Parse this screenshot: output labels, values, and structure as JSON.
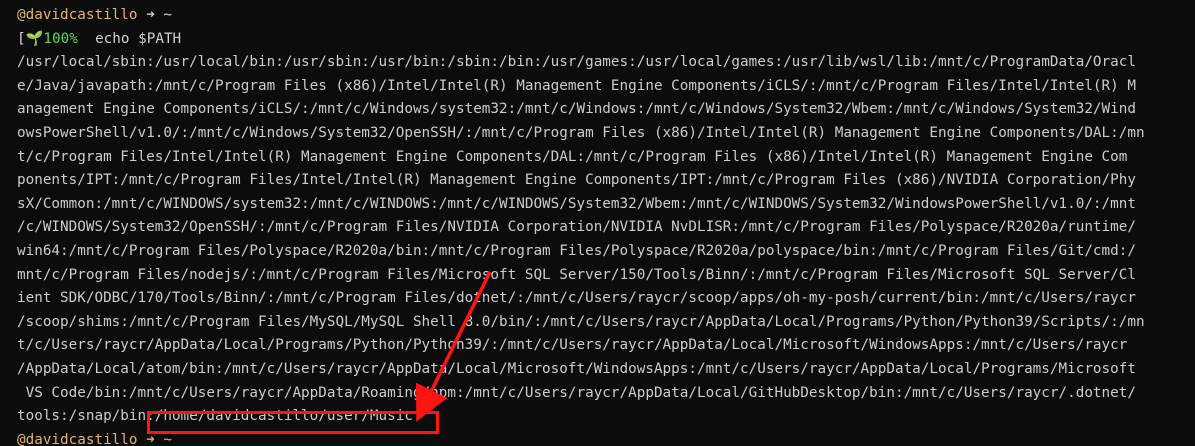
{
  "terminal": {
    "prompt_user": "@davidcastillo",
    "prompt_arrow": "➜",
    "prompt_dir": "~",
    "battery_icon": "seedling-icon",
    "battery_open": "[",
    "battery_glyph": "🌱",
    "battery_pct": "100%",
    "command": "echo $PATH",
    "output_lines": [
      "/usr/local/sbin:/usr/local/bin:/usr/sbin:/usr/bin:/sbin:/bin:/usr/games:/usr/local/games:/usr/lib/wsl/lib:/mnt/c/ProgramData/Oracl",
      "e/Java/javapath:/mnt/c/Program Files (x86)/Intel/Intel(R) Management Engine Components/iCLS/:/mnt/c/Program Files/Intel/Intel(R) M",
      "anagement Engine Components/iCLS/:/mnt/c/Windows/system32:/mnt/c/Windows:/mnt/c/Windows/System32/Wbem:/mnt/c/Windows/System32/Wind",
      "owsPowerShell/v1.0/:/mnt/c/Windows/System32/OpenSSH/:/mnt/c/Program Files (x86)/Intel/Intel(R) Management Engine Components/DAL:/mn",
      "t/c/Program Files/Intel/Intel(R) Management Engine Components/DAL:/mnt/c/Program Files (x86)/Intel/Intel(R) Management Engine Com",
      "ponents/IPT:/mnt/c/Program Files/Intel/Intel(R) Management Engine Components/IPT:/mnt/c/Program Files (x86)/NVIDIA Corporation/Phy",
      "sX/Common:/mnt/c/WINDOWS/system32:/mnt/c/WINDOWS:/mnt/c/WINDOWS/System32/Wbem:/mnt/c/WINDOWS/System32/WindowsPowerShell/v1.0/:/mnt",
      "/c/WINDOWS/System32/OpenSSH/:/mnt/c/Program Files/NVIDIA Corporation/NVIDIA NvDLISR:/mnt/c/Program Files/Polyspace/R2020a/runtime/",
      "win64:/mnt/c/Program Files/Polyspace/R2020a/bin:/mnt/c/Program Files/Polyspace/R2020a/polyspace/bin:/mnt/c/Program Files/Git/cmd:/",
      "mnt/c/Program Files/nodejs/:/mnt/c/Program Files/Microsoft SQL Server/150/Tools/Binn/:/mnt/c/Program Files/Microsoft SQL Server/Cl",
      "ient SDK/ODBC/170/Tools/Binn/:/mnt/c/Program Files/dotnet/:/mnt/c/Users/raycr/scoop/apps/oh-my-posh/current/bin:/mnt/c/Users/raycr",
      "/scoop/shims:/mnt/c/Program Files/MySQL/MySQL Shell 8.0/bin/:/mnt/c/Users/raycr/AppData/Local/Programs/Python/Python39/Scripts/:/mn",
      "t/c/Users/raycr/AppData/Local/Programs/Python/Python39/:/mnt/c/Users/raycr/AppData/Local/Microsoft/WindowsApps:/mnt/c/Users/raycr",
      "/AppData/Local/atom/bin:/mnt/c/Users/raycr/AppData/Local/Microsoft/WindowsApps:/mnt/c/Users/raycr/AppData/Local/Programs/Microsoft",
      " VS Code/bin:/mnt/c/Users/raycr/AppData/Roaming/npm:/mnt/c/Users/raycr/AppData/Local/GitHubDesktop/bin:/mnt/c/Users/raycr/.dotnet/"
    ],
    "last_line_prefix": "tools:/snap/bin",
    "last_line_highlight": ":/home/davidcastillo/user/Music",
    "next_prompt": "@davidcastillo ➜ ~"
  },
  "annotation": {
    "box_color": "#ff1414",
    "arrow_color": "#ff1414"
  }
}
